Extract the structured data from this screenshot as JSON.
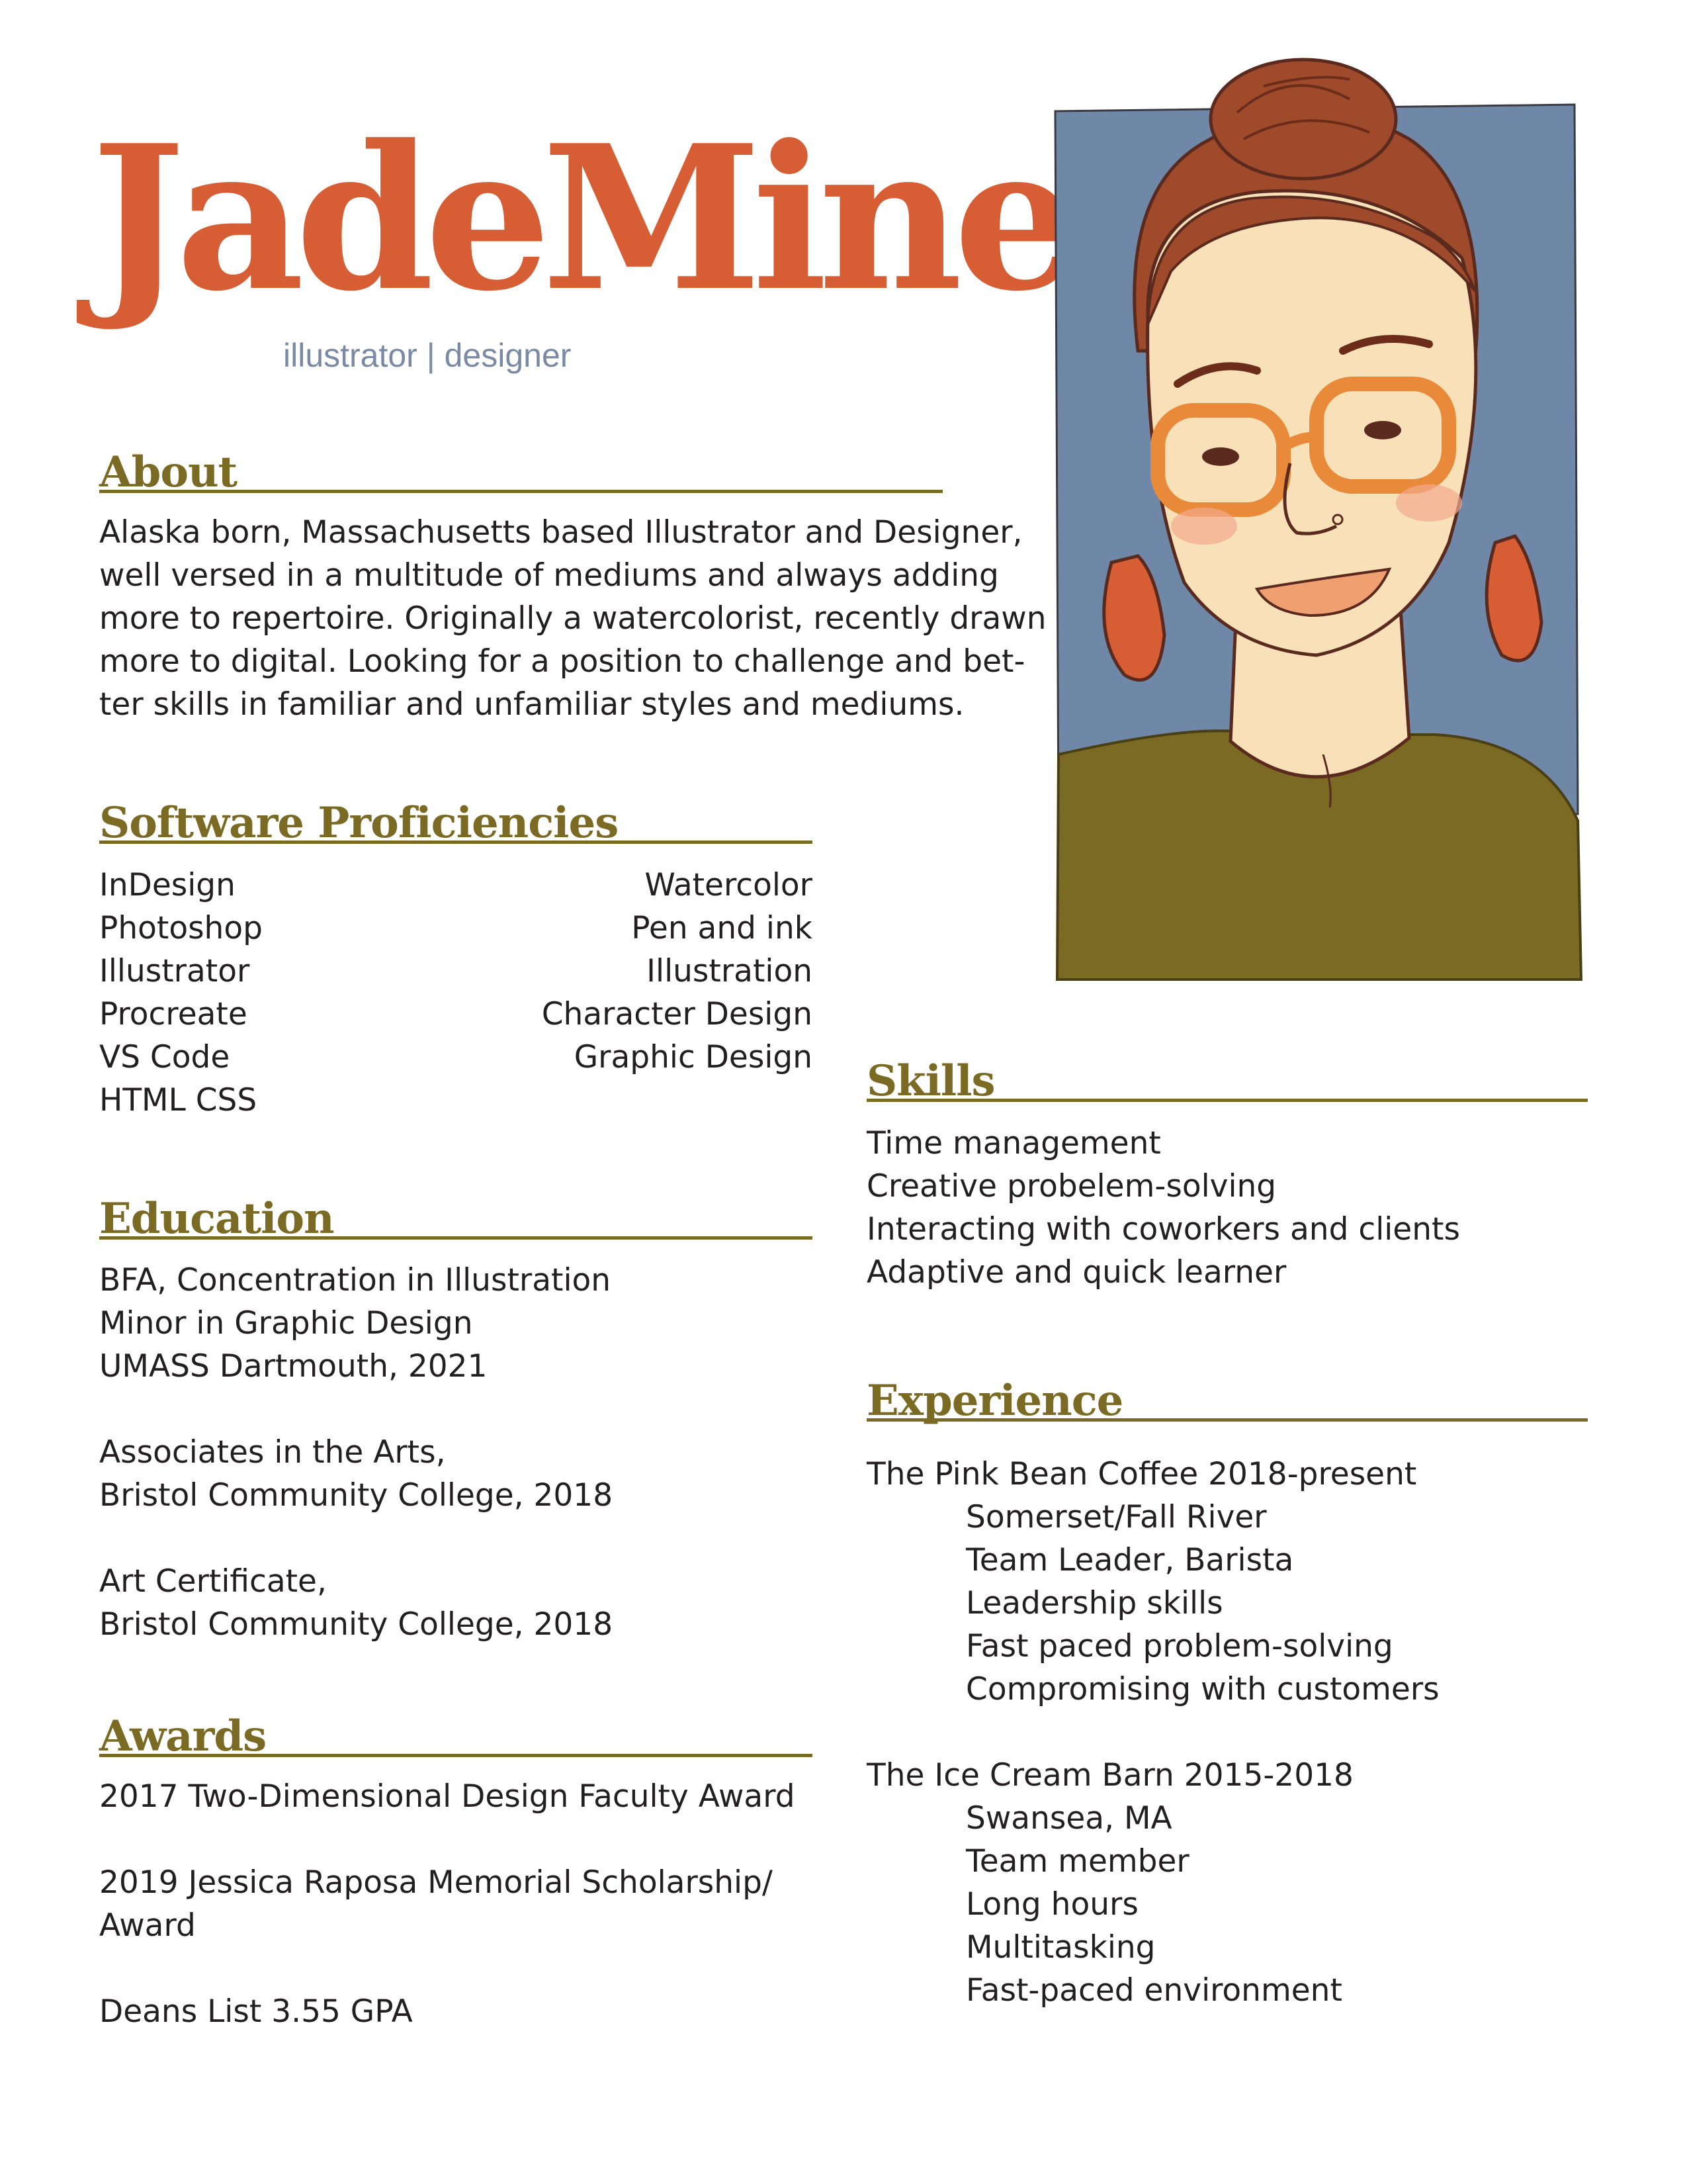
{
  "header": {
    "name": "JadeMiner",
    "tagline": "illustrator | designer"
  },
  "about": {
    "heading": "About",
    "lines": [
      "Alaska born, Massachusetts based Illustrator and Designer,",
      "well versed in a multitude of mediums and always adding",
      "more to repertoire. Originally a watercolorist, recently drawn",
      "more to digital. Looking for a position to challenge and bet-",
      "ter skills in familiar and unfamiliar styles and mediums."
    ]
  },
  "software": {
    "heading": "Software Proficiencies",
    "left": [
      "InDesign",
      "Photoshop",
      "Illustrator",
      "Procreate",
      "VS Code",
      "HTML CSS"
    ],
    "right": [
      "Watercolor",
      "Pen and ink",
      "Illustration",
      "Character Design",
      "Graphic Design"
    ]
  },
  "education": {
    "heading": "Education",
    "entries": [
      [
        "BFA, Concentration in Illustration",
        "Minor in Graphic Design",
        "UMASS Dartmouth, 2021"
      ],
      [
        "Associates in the Arts,",
        "Bristol Community College, 2018"
      ],
      [
        "Art Certificate,",
        "Bristol Community College, 2018"
      ]
    ]
  },
  "awards": {
    "heading": "Awards",
    "entries": [
      [
        "2017 Two-Dimensional Design Faculty Award"
      ],
      [
        "2019 Jessica Raposa Memorial Scholarship/",
        "Award"
      ],
      [
        "Deans List 3.55 GPA"
      ]
    ]
  },
  "skills": {
    "heading": "Skills",
    "items": [
      "Time management",
      "Creative probelem-solving",
      "Interacting with coworkers and clients",
      "Adaptive and quick learner"
    ]
  },
  "experience": {
    "heading": "Experience",
    "jobs": [
      {
        "title": "The Pink Bean Coffee 2018-present",
        "details": [
          "Somerset/Fall River",
          "Team Leader, Barista",
          "Leadership skills",
          "Fast paced problem-solving",
          "Compromising with customers"
        ]
      },
      {
        "title": "The Ice Cream Barn 2015-2018",
        "details": [
          "Swansea, MA",
          "Team member",
          "Long hours",
          "Multitasking",
          "Fast-paced environment"
        ]
      }
    ]
  },
  "colors": {
    "name": "#d65d34",
    "tagline": "#7a8aa5",
    "heading": "#7a6a23",
    "portrait_background": "#6f88a8",
    "portrait_shirt": "#7a6a23",
    "portrait_skin": "#f8e0b8",
    "portrait_hair": "#a04a2c"
  },
  "portrait": {
    "icon": "self-portrait-illustration"
  }
}
